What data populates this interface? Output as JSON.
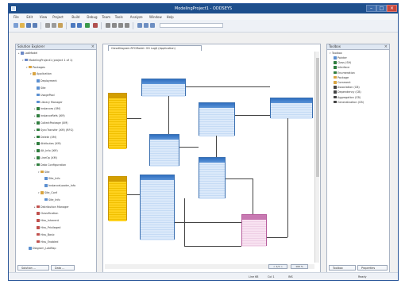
{
  "window": {
    "title": "ModelingProject1 - ODDSEYS"
  },
  "menubar": {
    "items": [
      "File",
      "Edit",
      "View",
      "Project",
      "Build",
      "Debug",
      "Team",
      "Tools",
      "Analyze",
      "Window",
      "Help"
    ]
  },
  "left_pane": {
    "title": "Solution Explorer",
    "tree": [
      {
        "label": "LabModel",
        "level": 0,
        "icon": "#6b88c6",
        "exp": "▸"
      },
      {
        "label": "ModelingProject1 (project 1 of 1)",
        "level": 1,
        "icon": "#6b88c6",
        "exp": "▾"
      },
      {
        "label": "Packages",
        "level": 2,
        "icon": "#d9a441",
        "exp": "▾"
      },
      {
        "label": "Application",
        "level": 3,
        "icon": "#d9a441",
        "exp": "▾"
      },
      {
        "label": "Deployment",
        "level": 4,
        "icon": "#5b8fd0",
        "exp": ""
      },
      {
        "label": "Site",
        "level": 4,
        "icon": "#5b8fd0",
        "exp": ""
      },
      {
        "label": "UsagePool",
        "level": 4,
        "icon": "#5b8fd0",
        "exp": ""
      },
      {
        "label": "Library Manager",
        "level": 4,
        "icon": "#5b8fd0",
        "exp": ""
      },
      {
        "label": "Instances (XM)",
        "level": 4,
        "icon": "#2f7d3e",
        "exp": "▸"
      },
      {
        "label": "InstanceRefs (XM)",
        "level": 4,
        "icon": "#2f7d3e",
        "exp": "▸"
      },
      {
        "label": "CollectPackage (XM)",
        "level": 4,
        "icon": "#2f7d3e",
        "exp": "▸"
      },
      {
        "label": "SyncTransfer (XM) (RFG)",
        "level": 4,
        "icon": "#2f7d3e",
        "exp": "▸"
      },
      {
        "label": "Delete (XM)",
        "level": 4,
        "icon": "#2f7d3e",
        "exp": "▸"
      },
      {
        "label": "Attributes (XM)",
        "level": 4,
        "icon": "#2f7d3e",
        "exp": "▸"
      },
      {
        "label": "Alt_Info (XM)",
        "level": 4,
        "icon": "#2f7d3e",
        "exp": "▸"
      },
      {
        "label": "LineOp (XM)",
        "level": 4,
        "icon": "#2f7d3e",
        "exp": "▸"
      },
      {
        "label": "Data Configuration",
        "level": 4,
        "icon": "#2f7d3e",
        "exp": "▾"
      },
      {
        "label": "Site",
        "level": 5,
        "icon": "#d9a441",
        "exp": "▾"
      },
      {
        "label": "Site_Info",
        "level": 6,
        "icon": "#5b8fd0",
        "exp": ""
      },
      {
        "label": "InstanceLoader_Info",
        "level": 6,
        "icon": "#5b8fd0",
        "exp": ""
      },
      {
        "label": "Site_Conf",
        "level": 5,
        "icon": "#d9a441",
        "exp": "▾"
      },
      {
        "label": "Site_Info",
        "level": 6,
        "icon": "#5b8fd0",
        "exp": ""
      },
      {
        "label": "Distribution Manager",
        "level": 4,
        "icon": "#c0504d",
        "exp": "▸"
      },
      {
        "label": "Classification",
        "level": 4,
        "icon": "#c0504d",
        "exp": ""
      },
      {
        "label": "Hiss_Inherent",
        "level": 4,
        "icon": "#c0504d",
        "exp": ""
      },
      {
        "label": "Hiss_Privileged",
        "level": 4,
        "icon": "#c0504d",
        "exp": ""
      },
      {
        "label": "Hiss_Basic",
        "level": 4,
        "icon": "#c0504d",
        "exp": ""
      },
      {
        "label": "Hiss_Enabled",
        "level": 4,
        "icon": "#c0504d",
        "exp": ""
      },
      {
        "label": "Diagram_LabMap",
        "level": 2,
        "icon": "#5b8fd0",
        "exp": ""
      }
    ],
    "bottom_tabs": [
      "Solution ...",
      "Data ..."
    ]
  },
  "doc": {
    "tab_label": "ClassDiagram.RFCModel: OG Log$ (Application)"
  },
  "canvas": {
    "page_buttons": [
      "< 1/1 >",
      "100 %"
    ]
  },
  "right_pane": {
    "title": "Toolbox",
    "section": "Toolbox",
    "items": [
      {
        "label": "Pointer",
        "icon": "#5b8fd0"
      },
      {
        "label": "Class (SH)",
        "icon": "#2f7d3e"
      },
      {
        "label": "Interface",
        "icon": "#2f7d3e"
      },
      {
        "label": "Enumeration",
        "icon": "#2f7d3e"
      },
      {
        "label": "Package",
        "icon": "#d9a441"
      },
      {
        "label": "Comment",
        "icon": "#d9a441"
      },
      {
        "label": "Association (CB)",
        "icon": "#444444"
      },
      {
        "label": "Dependency (CB)",
        "icon": "#444444"
      },
      {
        "label": "Aggregation (CB)",
        "icon": "#444444"
      },
      {
        "label": "Generalization (CB)",
        "icon": "#444444"
      }
    ],
    "bottom_tabs": [
      "Toolbox",
      "Properties"
    ]
  },
  "status": {
    "ln": "Line 68",
    "col": "Col 1",
    "mode": "INS",
    "ready": "Ready"
  }
}
